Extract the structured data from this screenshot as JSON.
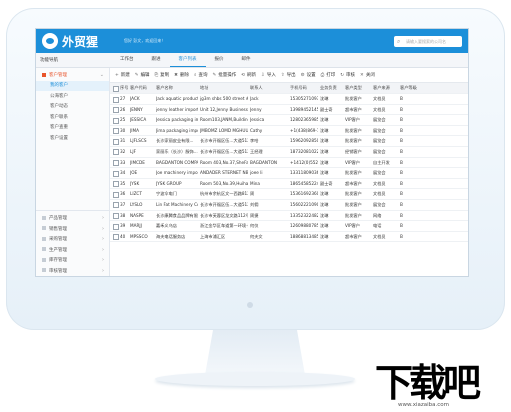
{
  "app": {
    "name": "外贸猩",
    "welcome": "您好 彭文，欢迎回来！",
    "search_placeholder": "请输入要搜索的公司名"
  },
  "sidebar": {
    "title": "功能导航",
    "items": [
      {
        "label": "客户管理"
      },
      {
        "label": "产品管理"
      },
      {
        "label": "销售管理"
      },
      {
        "label": "采购管理"
      },
      {
        "label": "生产管理"
      },
      {
        "label": "库存管理"
      },
      {
        "label": "审核管理"
      }
    ],
    "subitems": [
      {
        "label": "我的客户"
      },
      {
        "label": "公海客户"
      },
      {
        "label": "客户动态"
      },
      {
        "label": "客户联系"
      },
      {
        "label": "客户查重"
      },
      {
        "label": "客户设置"
      }
    ]
  },
  "tabs": [
    {
      "label": "工作台"
    },
    {
      "label": "跟进"
    },
    {
      "label": "客户列表"
    },
    {
      "label": "报价"
    },
    {
      "label": "邮件"
    }
  ],
  "toolbar": [
    {
      "icon": "+",
      "label": "新建"
    },
    {
      "icon": "✎",
      "label": "编辑"
    },
    {
      "icon": "⎘",
      "label": "复制"
    },
    {
      "icon": "✖",
      "label": "删除"
    },
    {
      "icon": "⌕",
      "label": "查询"
    },
    {
      "icon": "✎",
      "label": "批量操作"
    },
    {
      "icon": "⟲",
      "label": "刷新"
    },
    {
      "icon": "⇩",
      "label": "导入"
    },
    {
      "icon": "⇧",
      "label": "导出"
    },
    {
      "icon": "⚙",
      "label": "设置"
    },
    {
      "icon": "⎙",
      "label": "打印"
    },
    {
      "icon": "↻",
      "label": "审核"
    },
    {
      "icon": "✕",
      "label": "关闭"
    }
  ],
  "table": {
    "headers": [
      "序号",
      "客户代码",
      "客户名称",
      "地址",
      "联系人",
      "手机号码",
      "业务负责",
      "客户类型",
      "客户来源",
      "客户等级"
    ],
    "rows": [
      [
        "27",
        "JACK",
        "Jack aquatic products im...",
        "jg3m shbs 500 street #23",
        "Jack",
        "15305271093",
        "沈琳",
        "批发客户",
        "文档员",
        "B"
      ],
      [
        "26",
        "JENNY",
        "jenny leather import and...",
        "Unit 12,Jenny Business Park,He...",
        "Jenny",
        "13989452145",
        "副士奇",
        "超市客户",
        "文档员",
        "B"
      ],
      [
        "25",
        "JESSICA",
        "Jessica packaging import a...",
        "Room103,JANM,Building3,No.5...",
        "Jessica",
        "12802365985",
        "沈琳",
        "VIP客户",
        "展览会",
        "B"
      ],
      [
        "30",
        "JIMA",
        "Jima packaging import an...",
        "JMBOMZ LOMD MGHUU S...",
        "Cathy",
        "+1(438)869-1203",
        "沈琳",
        "批发客户",
        "展览会",
        "B"
      ],
      [
        "31",
        "LJFLSCS",
        "长沙家丽皮业有限...",
        "长沙市开福区伍…大道5123号",
        "李哈",
        "15962092850",
        "沈琳",
        "批发客户",
        "展览会",
        "B"
      ],
      [
        "32",
        "LJF",
        "家丽乐（长沙）服饰...",
        "长沙市开福区伍…大道5123号",
        "王经理",
        "18732081022",
        "沈琳",
        "经销客户",
        "展览会",
        "B"
      ],
      [
        "33",
        "JIMCDE",
        "BAGDANTON COMPANY",
        "Room 403,No.37,SheFan Road...",
        "BAGDANTON",
        "+1412(0)5523-14711",
        "沈琳",
        "VIP客户",
        "自主开发",
        "B"
      ],
      [
        "34",
        "JOE",
        "Joe machinery import and...",
        "ANDADER STERNET NBON #",
        "joee li",
        "13311809036",
        "沈琳",
        "批发客户",
        "展览会",
        "B"
      ],
      [
        "35",
        "JYSK",
        "JYSK GROUP",
        "Room 503,No.39,Huihai Wa...",
        "Mina",
        "18654585224",
        "副士奇",
        "超市客户",
        "文档员",
        "B"
      ],
      [
        "36",
        "LIZCT",
        "宁波伞电门",
        "杭州市余杭区文一西路812号",
        "周",
        "15361692360",
        "沈琳",
        "批发客户",
        "文档员",
        "B"
      ],
      [
        "37",
        "LYSLO",
        "Lin Fat Machinery Co...",
        "长沙市开福区伍…大道5123号",
        "刘佣",
        "15602221090",
        "沈琳",
        "批发客户",
        "展览会",
        "B"
      ],
      [
        "38",
        "NASPE",
        "长沙康腾食品品牌有限公司",
        "长沙市芙蓉区龙文路112号",
        "周捷",
        "13352322482",
        "沈琳",
        "批发客户",
        "网络",
        "B"
      ],
      [
        "39",
        "MARJJ",
        "嘉禾义乌店",
        "浙江金华区车道第一环境卡号门2号",
        "何仪",
        "12609880785",
        "沈琳",
        "VIP客户",
        "电话",
        "B"
      ],
      [
        "40",
        "MPSSCO",
        "海夫电话服务店",
        "上海市浦汇区",
        "何夫文",
        "18868813485",
        "沈琳",
        "超市客户",
        "文档员",
        "B"
      ]
    ]
  },
  "watermark": {
    "text": "下载吧",
    "url": "www.xiazaiba.com"
  },
  "colors": {
    "primary": "#1c8fd9",
    "accent": "#e8542b"
  }
}
